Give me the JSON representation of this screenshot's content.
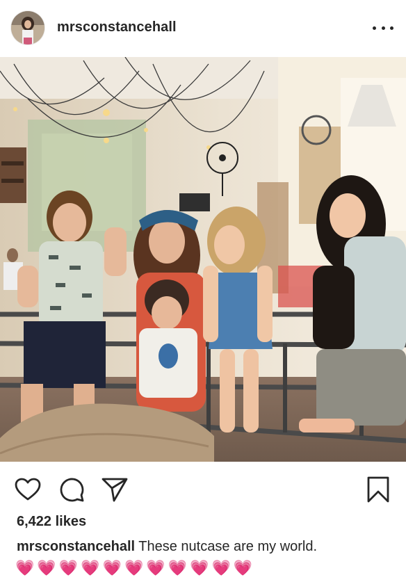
{
  "post": {
    "username": "mrsconstancehall",
    "likes": "6,422 likes",
    "caption_user": "mrsconstancehall",
    "caption_text": " These nutcase are my world.",
    "caption_emojis": "💗💗💗💗💗💗💗💗💗💗💗"
  },
  "icons": {
    "more": "more-options-icon",
    "like": "heart-icon",
    "comment": "comment-icon",
    "share": "paper-plane-icon",
    "save": "bookmark-icon"
  },
  "colors": {
    "text": "#262626",
    "heart_emoji": "#e75aa6"
  }
}
